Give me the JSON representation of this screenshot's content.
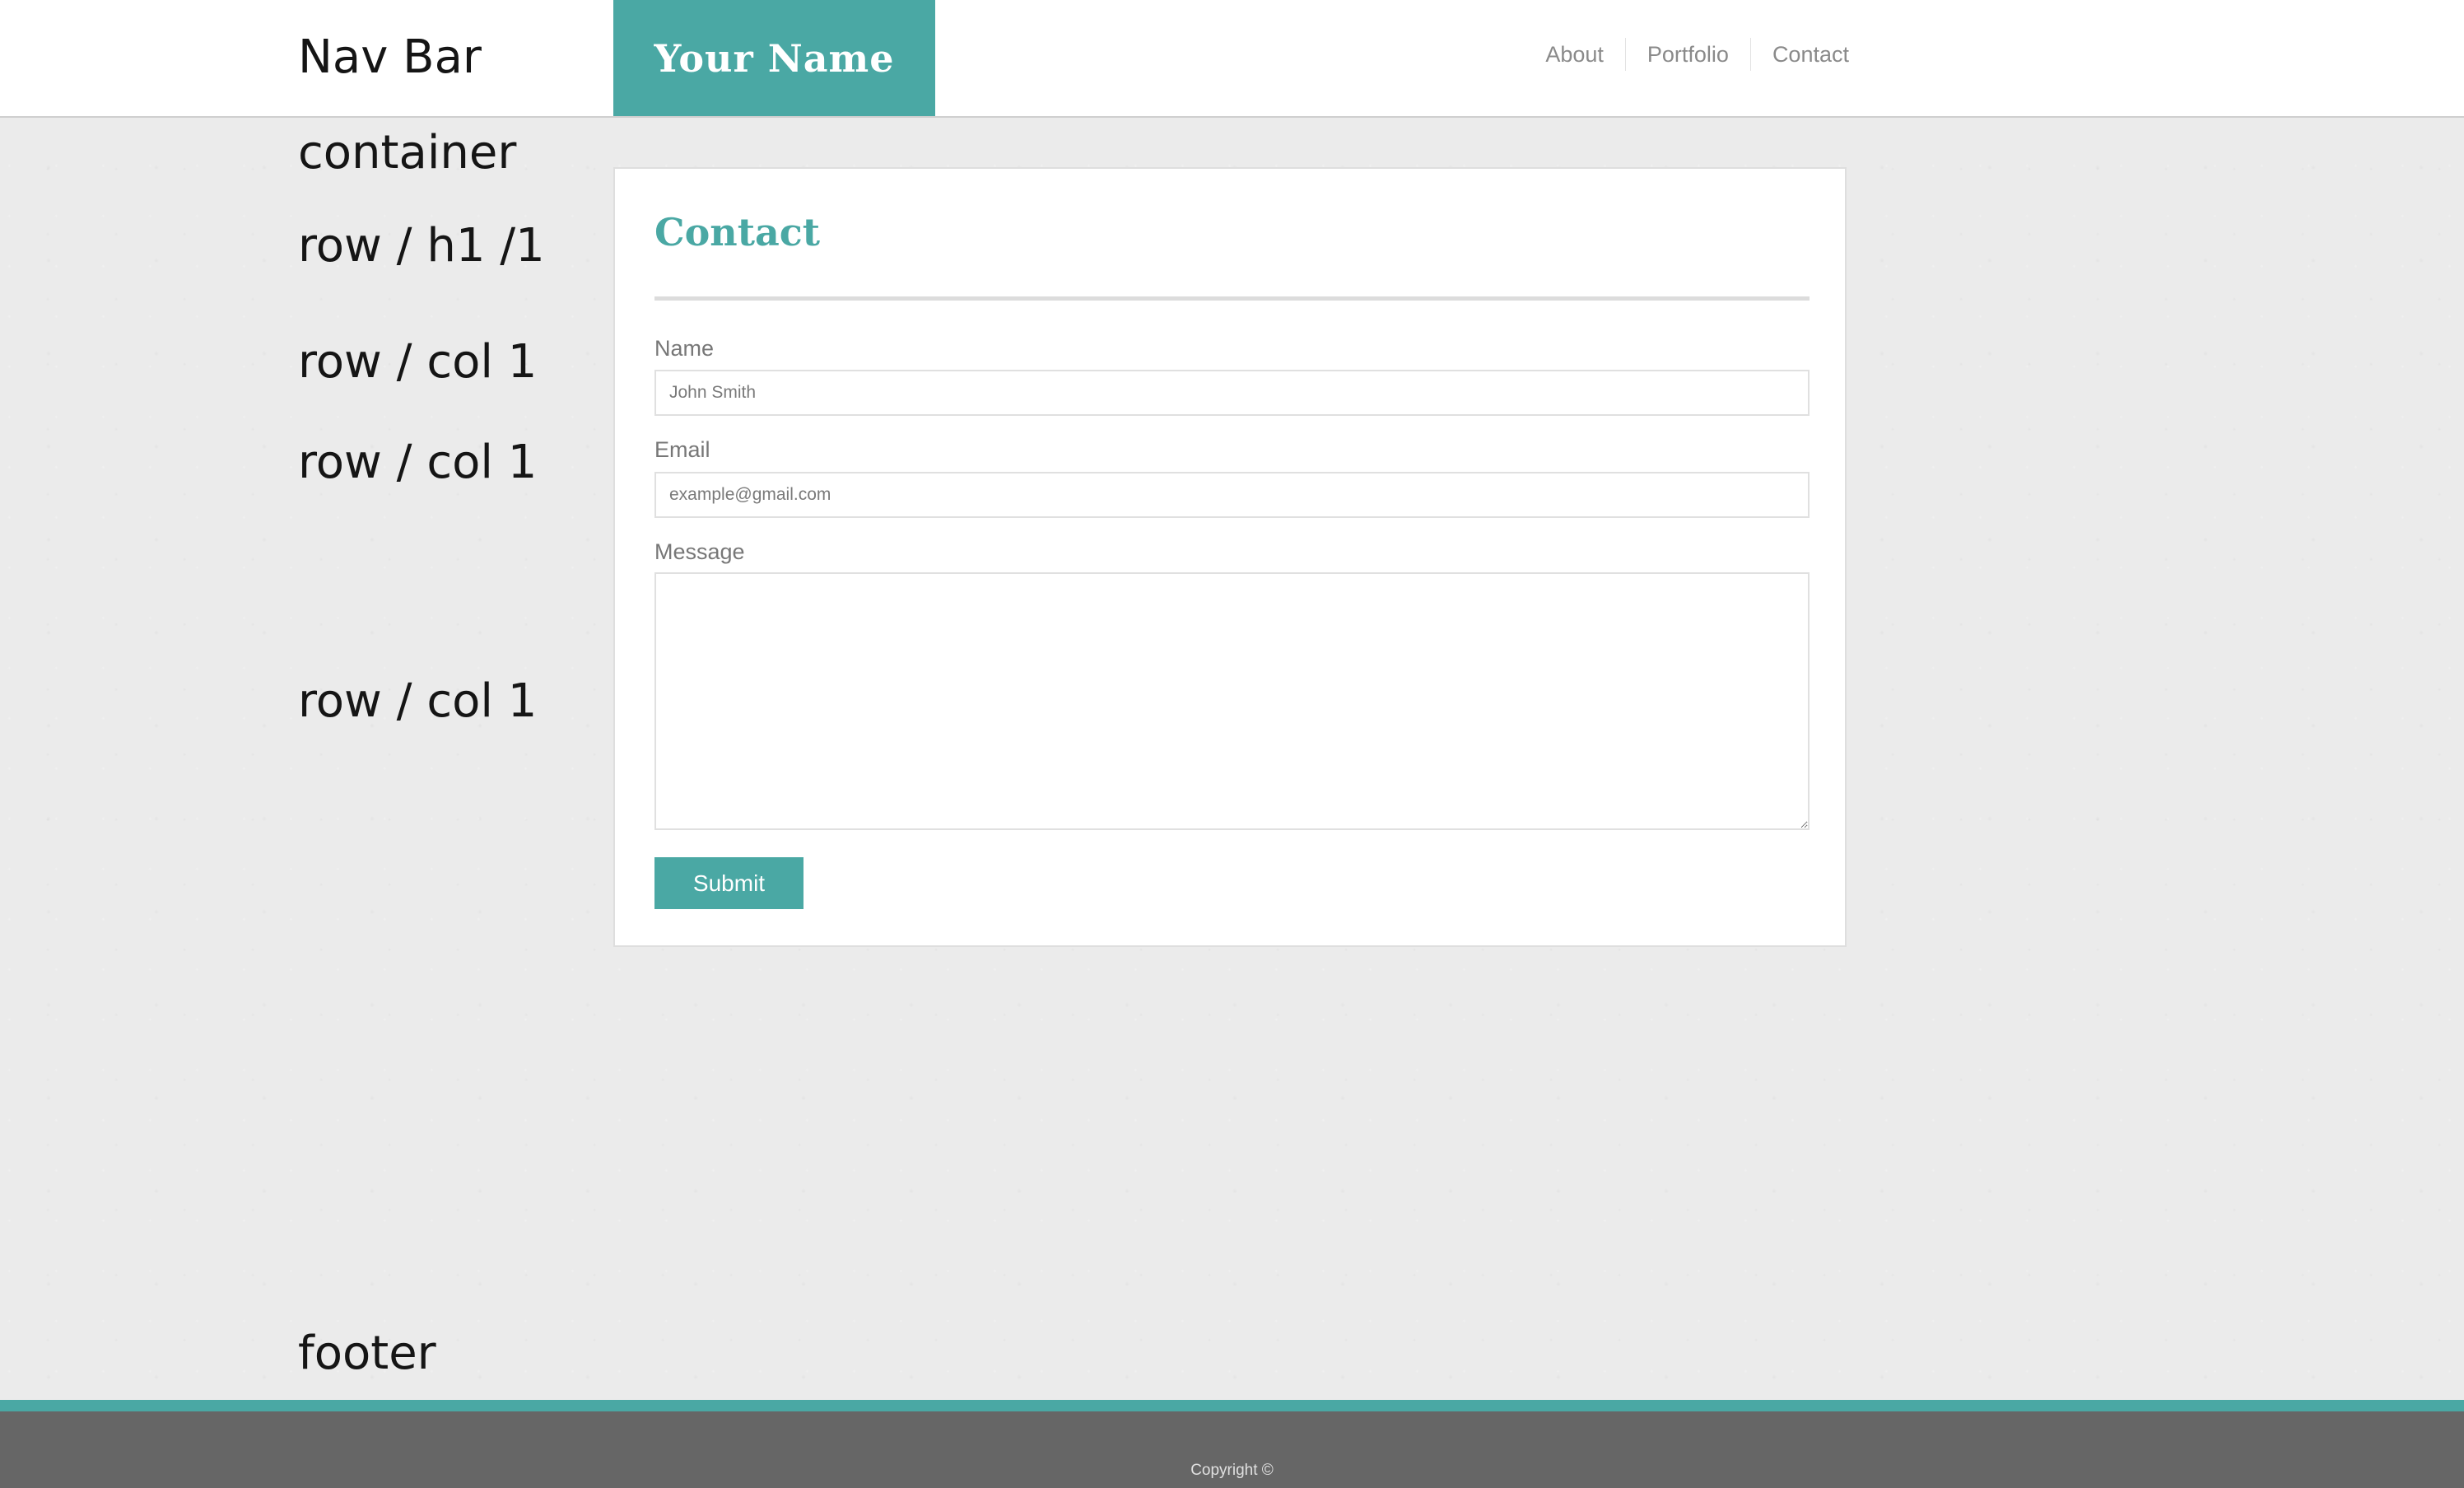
{
  "annotations": {
    "nav_bar": "Nav Bar",
    "container": "container",
    "row_h1": "row / h1 /1",
    "row_col_1": "row / col 1",
    "row_col_2": "row / col 1",
    "row_col_3": "row / col 1",
    "footer": "footer"
  },
  "navbar": {
    "brand": "Your Name",
    "links": [
      {
        "label": "About"
      },
      {
        "label": "Portfolio"
      },
      {
        "label": "Contact"
      }
    ]
  },
  "contact_form": {
    "title": "Contact",
    "name_label": "Name",
    "name_placeholder": "John Smith",
    "email_label": "Email",
    "email_placeholder": "example@gmail.com",
    "message_label": "Message",
    "submit_label": "Submit"
  },
  "footer": {
    "copyright": "Copyright ©"
  },
  "colors": {
    "accent": "#4aa8a4",
    "footer_bg": "#666666",
    "page_bg": "#ebebeb"
  }
}
